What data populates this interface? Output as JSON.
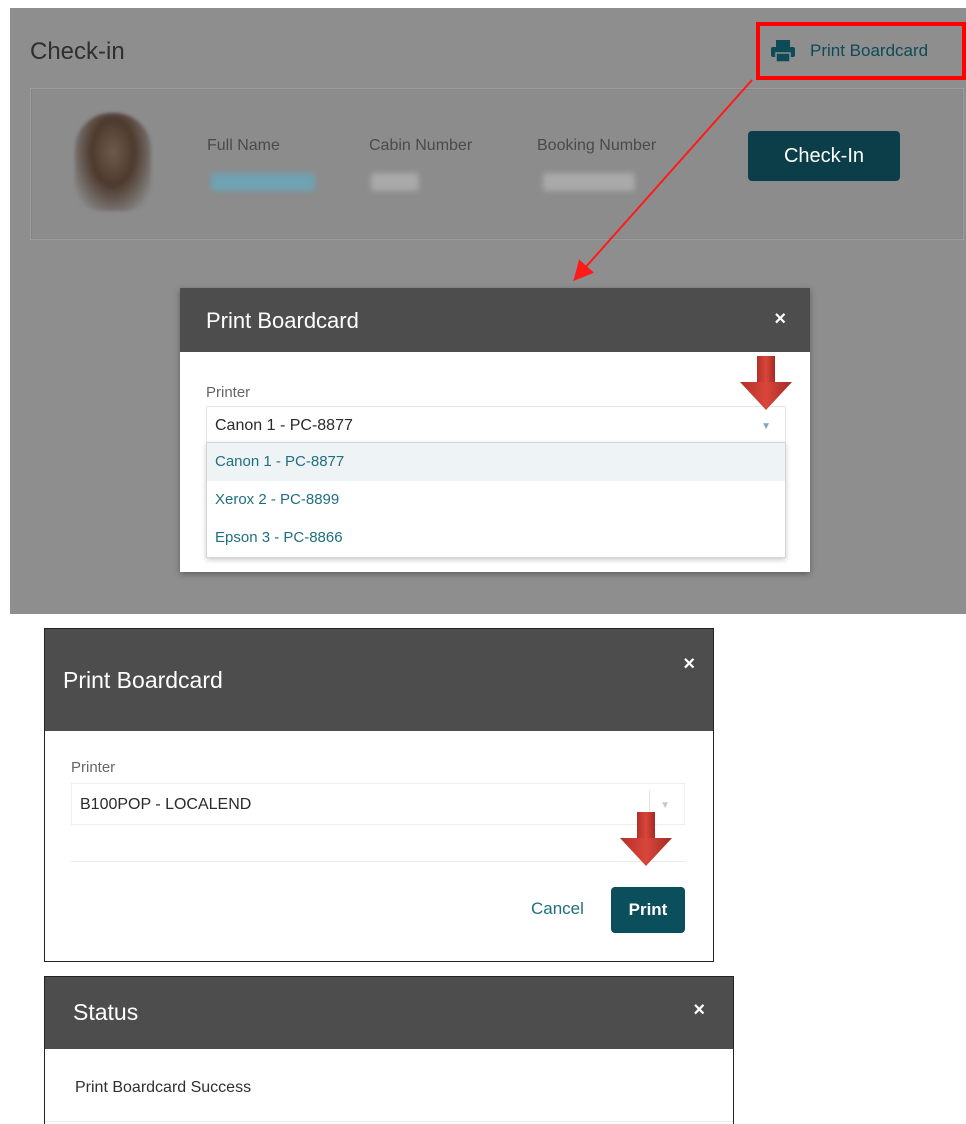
{
  "checkin_page": {
    "title": "Check-in",
    "print_link_label": "Print Boardcard",
    "fields": {
      "full_name_label": "Full Name",
      "cabin_number_label": "Cabin Number",
      "booking_number_label": "Booking Number"
    },
    "checkin_button": "Check-In"
  },
  "print_dialog_1": {
    "title": "Print Boardcard",
    "close": "×",
    "printer_label": "Printer",
    "printer_value": "Canon 1 - PC-8877",
    "options": [
      "Canon 1 - PC-8877",
      "Xerox 2 - PC-8899",
      "Epson 3 - PC-8866"
    ]
  },
  "print_dialog_2": {
    "title": "Print Boardcard",
    "close": "×",
    "printer_label": "Printer",
    "printer_value": "B100POP - LOCALEND",
    "cancel": "Cancel",
    "print": "Print"
  },
  "status_dialog": {
    "title": "Status",
    "close": "×",
    "message": "Print Boardcard Success"
  },
  "colors": {
    "accent": "#0b4e5c",
    "highlight": "#ff0000",
    "arrow": "#c0392b",
    "header": "#4d4d4d"
  }
}
